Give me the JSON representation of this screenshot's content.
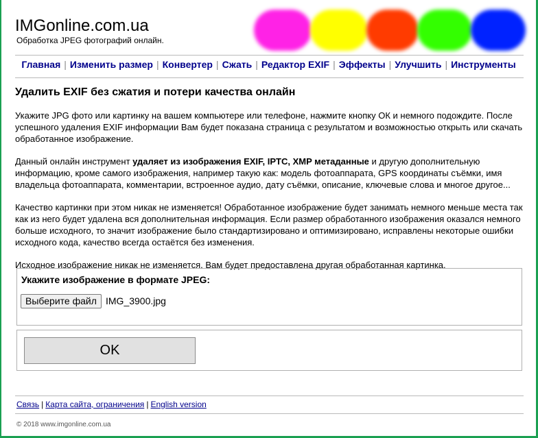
{
  "site": {
    "logo": "IMGonline.com.ua",
    "tagline": "Обработка JPEG фотографий онлайн.",
    "colors": [
      "#ff22e6",
      "#ffff00",
      "#ff3b00",
      "#33ff00",
      "#0022ff"
    ]
  },
  "nav": {
    "items": [
      {
        "label": "Главная"
      },
      {
        "label": "Изменить размер"
      },
      {
        "label": "Конвертер"
      },
      {
        "label": "Сжать"
      },
      {
        "label": "Редактор EXIF"
      },
      {
        "label": "Эффекты"
      },
      {
        "label": "Улучшить"
      },
      {
        "label": "Инструменты"
      }
    ],
    "separator": "|"
  },
  "main": {
    "title": "Удалить EXIF без сжатия и потери качества онлайн",
    "p1": "Укажите JPG фото или картинку на вашем компьютере или телефоне, нажмите кнопку ОК и немного подождите. После успешного удаления EXIF информации Вам будет показана страница с результатом и возможностью открыть или скачать обработанное изображение.",
    "p2_pre": "Данный онлайн инструмент ",
    "p2_bold": "удаляет из изображения EXIF, IPTC, XMP метаданные",
    "p2_post": " и другую дополнительную информацию, кроме самого изображения, например такую как: модель фотоаппарата, GPS координаты съёмки, имя владельца фотоаппарата, комментарии, встроенное аудио, дату съёмки, описание, ключевые слова и многое другое...",
    "p3": "Качество картинки при этом никак не изменяется! Обработанное изображение будет занимать немного меньше места так как из него будет удалена вся дополнительная информация. Если размер обработанного изображения оказался немного больше исходного, то значит изображение было стандартизировано и оптимизировано, исправлены некоторые ошибки исходного кода, качество всегда остаётся без изменения.",
    "p4": "Исходное изображение никак не изменяется. Вам будет предоставлена другая обработанная картинка."
  },
  "upload": {
    "title": "Укажите изображение в формате JPEG:",
    "button_label": "Выберите файл",
    "file_name": "IMG_3900.jpg"
  },
  "submit": {
    "label": "OK"
  },
  "footer": {
    "links": [
      {
        "label": "Связь"
      },
      {
        "label": "Карта сайта, ограничения"
      },
      {
        "label": "English version"
      }
    ],
    "copyright": "© 2018 www.imgonline.com.ua"
  }
}
